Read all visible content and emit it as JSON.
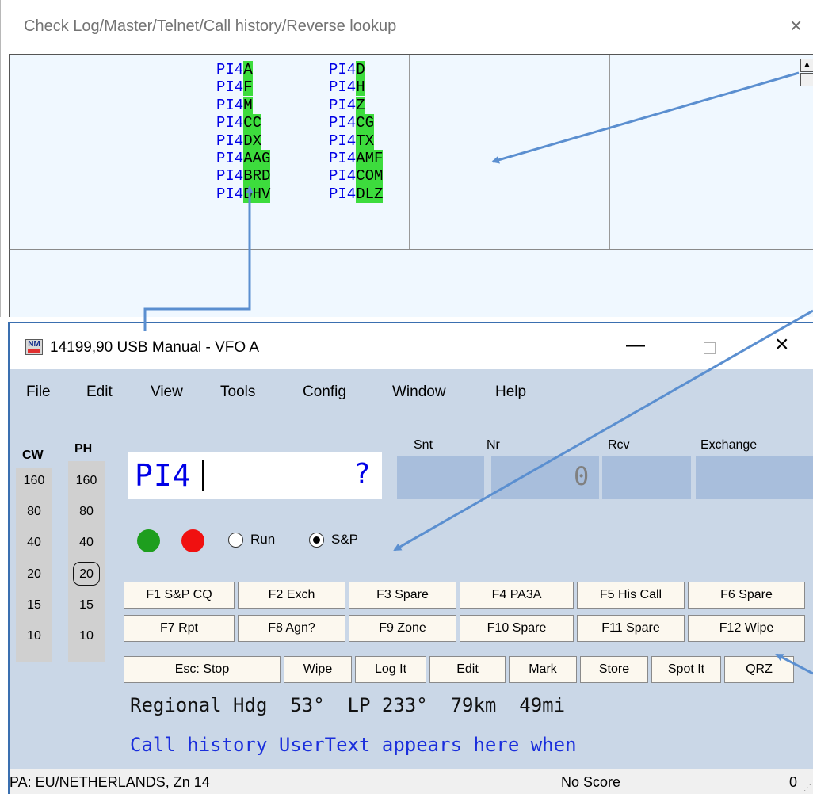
{
  "check_window": {
    "title": "Check Log/Master/Telnet/Call history/Reverse lookup",
    "close_glyph": "×",
    "scroll_up_glyph": "▲",
    "partial_calls": [
      [
        "PI4",
        "A"
      ],
      [
        "PI4",
        "F"
      ],
      [
        "PI4",
        "M"
      ],
      [
        "PI4",
        "CC"
      ],
      [
        "PI4",
        "DX"
      ],
      [
        "PI4",
        "AAG"
      ],
      [
        "PI4",
        "BRD"
      ],
      [
        "PI4",
        "DHV"
      ]
    ],
    "partial_calls_col2": [
      [
        "PI4",
        "D"
      ],
      [
        "PI4",
        "H"
      ],
      [
        "PI4",
        "Z"
      ],
      [
        "PI4",
        "CG"
      ],
      [
        "PI4",
        "TX"
      ],
      [
        "PI4",
        "AMF"
      ],
      [
        "PI4",
        "COM"
      ],
      [
        "PI4",
        "DLZ"
      ]
    ],
    "highlight_color": "#3ddc3d",
    "prefix_color": "#0000e6"
  },
  "main_window": {
    "title": "14199,90 USB Manual - VFO A",
    "logo_text": "NM",
    "minimize_glyph": "—",
    "close_glyph": "×",
    "menu": [
      "File",
      "Edit",
      "View",
      "Tools",
      "Config",
      "Window",
      "Help"
    ],
    "bands": {
      "cw_label": "CW",
      "ph_label": "PH",
      "cw": [
        "160",
        "80",
        "40",
        "20",
        "15",
        "10"
      ],
      "ph": [
        "160",
        "80",
        "40",
        "20",
        "15",
        "10"
      ],
      "active_ph_band": "20"
    },
    "fields": {
      "snt_label": "Snt",
      "nr_label": "Nr",
      "rcv_label": "Rcv",
      "exchange_label": "Exchange",
      "callsign_value": "PI4",
      "callsign_flag": "?",
      "nr_value": "0"
    },
    "indicators": {
      "green": "#1e9e1e",
      "red": "#f01010"
    },
    "mode": {
      "run_label": "Run",
      "sp_label": "S&P",
      "selected": "S&P"
    },
    "fkeys_row1": [
      "F1 S&P CQ",
      "F2 Exch",
      "F3 Spare",
      "F4 PA3A",
      "F5 His Call",
      "F6 Spare"
    ],
    "fkeys_row2": [
      "F7 Rpt",
      "F8 Agn?",
      "F9 Zone",
      "F10 Spare",
      "F11 Spare",
      "F12 Wipe"
    ],
    "buttons_row3": [
      "Esc: Stop",
      "Wipe",
      "Log It",
      "Edit",
      "Mark",
      "Store",
      "Spot It",
      "QRZ"
    ],
    "info_line": "Regional Hdg  53°  LP 233°  79km  49mi",
    "usertext_line": "Call history UserText appears here when",
    "status": {
      "left": "PA: EU/NETHERLANDS, Zn 14",
      "middle": "No Score",
      "right": "0"
    }
  },
  "colors": {
    "window_bg": "#cad7e7",
    "field_bg": "#a8bedc",
    "button_bg": "#fcf8ef",
    "annotation_arrow": "#5b8fd0",
    "callsign_text": "#0000e6"
  }
}
